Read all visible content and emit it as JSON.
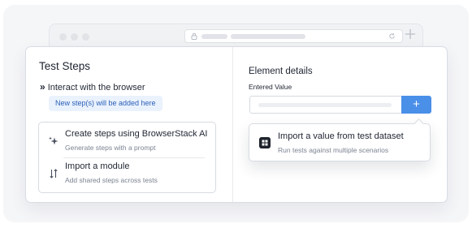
{
  "test_steps": {
    "title": "Test Steps",
    "interact_marker": "»",
    "interact_label": "Interact with the browser",
    "new_step_hint": "New step(s) will be added here",
    "options": [
      {
        "icon": "sparkle-icon",
        "title": "Create steps using BrowserStack AI",
        "subtitle": "Generate steps with a prompt"
      },
      {
        "icon": "arrows-up-down-icon",
        "title": "Import a module",
        "subtitle": "Add shared steps across tests"
      }
    ]
  },
  "element_details": {
    "title": "Element details",
    "entered_value_label": "Entered Value",
    "input_value": "",
    "add_button_label": "+"
  },
  "popover": {
    "icon": "dataset-grid-icon",
    "title": "Import a value from test dataset",
    "subtitle": "Run tests against multiple scenarios"
  },
  "colors": {
    "accent": "#4a8fe8",
    "pill_bg": "#eaf2fd",
    "pill_text": "#2a5fb8"
  }
}
